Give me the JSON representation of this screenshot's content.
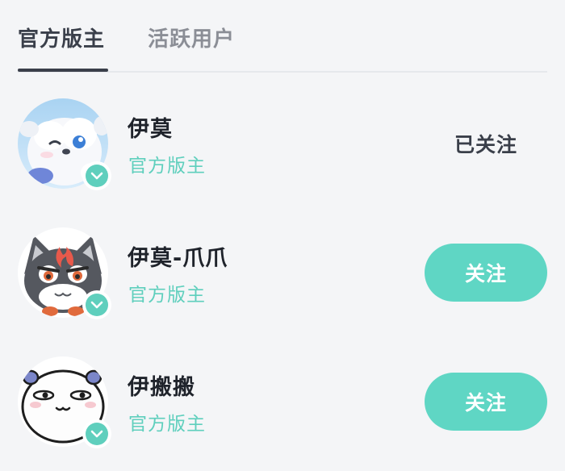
{
  "tabs": [
    {
      "label": "官方版主",
      "active": true
    },
    {
      "label": "活跃用户",
      "active": false
    }
  ],
  "moderators": [
    {
      "name": "伊莫",
      "role": "官方版主",
      "action_label": "已关注",
      "following": true,
      "avatar": "white-fluffy-puppy-avatar"
    },
    {
      "name": "伊莫-爪爪",
      "role": "官方版主",
      "action_label": "关注",
      "following": false,
      "avatar": "gray-cat-with-flame-avatar"
    },
    {
      "name": "伊搬搬",
      "role": "官方版主",
      "action_label": "关注",
      "following": false,
      "avatar": "doodle-panda-avatar"
    }
  ],
  "colors": {
    "accent": "#5fd6c4",
    "role_text": "#5fcfbd",
    "background": "#f4f5f7",
    "active_tab": "#3a3f4a",
    "inactive_tab": "#8b8e96"
  }
}
